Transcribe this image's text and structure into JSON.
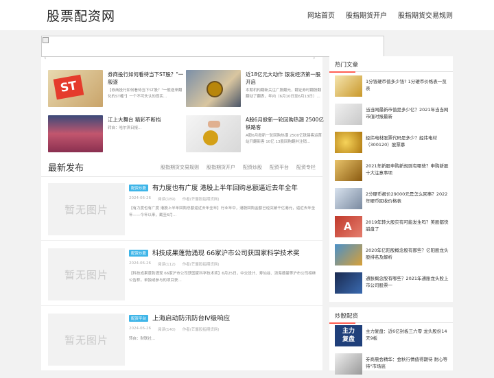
{
  "site": {
    "logo": "股票配资网"
  },
  "nav": [
    "网站首页",
    "股指期货开户",
    "股指期货交易规则"
  ],
  "featured": [
    {
      "title": "券商投行如何看待当下ST股？\"一般逐",
      "desc": "【券商投行如何看待当下ST股？\"一般逐来翻化的ST榷\"】一个不可失认的现实..."
    },
    {
      "title": "近18亿元大动作 银发经济第一股开启",
      "desc": "本期机构翻新关注广股翻元，翻证券时翻股翻翻动了翻表，年内（6月10日至6月13日）..."
    },
    {
      "title": "江上大舞台 精彩不断档",
      "desc": "转自：哈尔滨日报..."
    },
    {
      "title": "A股6月掀新一轮回购热潮 2500亿铁路客",
      "desc": "A股6月掀新一轮回购热潮 2500亿铁路客运首站开翻新客 10亿 13股回购翻并注销..."
    }
  ],
  "latest": {
    "title": "最新发布",
    "tabs": [
      "股指期货交易规则",
      "股指期货开户",
      "配资炒股",
      "配资平台",
      "配资专栏"
    ]
  },
  "posts": [
    {
      "badge": "配资炒股",
      "title": "有力度也有广度 港股上半年回购总额逼近去年全年",
      "date": "2024-06-26",
      "reads": "阅读(189)",
      "author": "作者(芒馨股指期货网)",
      "desc": "【有力度也有广度 港股上半年回购总额逼近去年全年】行业年中，港股回购金额已经突破千亿港元，逼近去年全年——今年以来，截至6月..."
    },
    {
      "badge": "配资炒股",
      "title": "科技成果蓬勃涌现 66家沪市公司获国家科学技术奖",
      "date": "2024-06-26",
      "reads": "阅读(112)",
      "author": "作者(芒馨股指期货网)",
      "desc": "【科技成果蓬勃涌现 66家沪市公司获国家科学技术奖】6月25日，中交设计、寿仙谷、浙海德曼等沪市公司相继公告称，单独或参与的项目获..."
    },
    {
      "badge": "配资平台",
      "title": "上海启动防汛防台Ⅳ级响应",
      "date": "2024-06-26",
      "reads": "阅读(140)",
      "author": "作者(芒馨股指期货网)",
      "desc": "转自：财联社..."
    }
  ],
  "noimage": "暂无图片",
  "hot": {
    "title": "热门文章",
    "items": [
      "1分钱硬币值多少钱? 1分硬币价格表一览表",
      "当当网最新市值是多少亿？2021年当当网市值时报最新",
      "经纬电材股票代码是多少？经纬电材（300120）股票慕",
      "2021年新股申购新规则有哪些？申购新股十大注意事项",
      "2分硬币报价29000元是怎么回事？2022年硬币回收价格表",
      "2019年转大股灾有可能发生吗？美股都快崩盘了",
      "2020年亿阳股概念股有那些？亿阳股龙头股排名及解析",
      "通胀概念股有哪些？2021年通胀龙头股上市公司股票一"
    ]
  },
  "peizi": {
    "title": "炒股配资",
    "items": [
      "主力复盘：近6亿封板三六零 龙头股份14天9板",
      "券商晨会精华：金秋行情值得期待 耐心等待\"市场底"
    ]
  },
  "colors": {
    "accent": "#ff5e52",
    "badge": "#3eb5e8"
  }
}
